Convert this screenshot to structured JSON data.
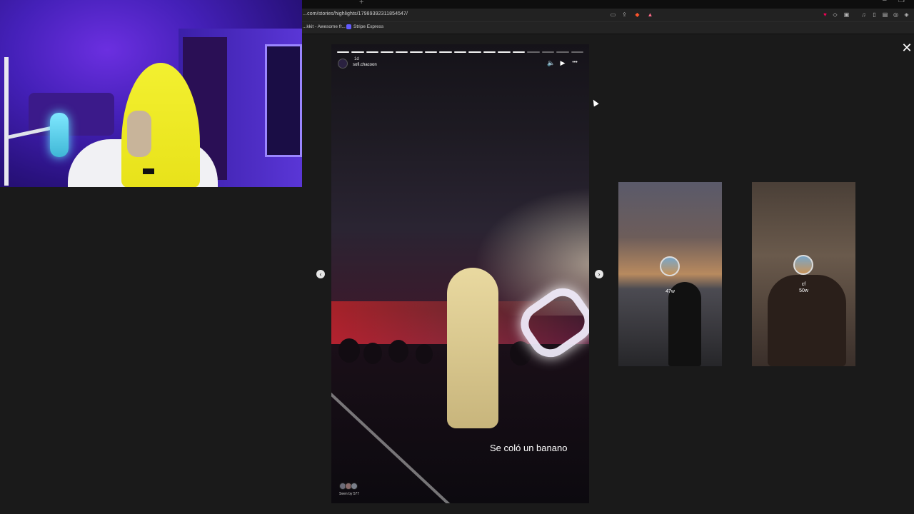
{
  "browser": {
    "url": "...com/stories/highlights/17989392311854547/",
    "bookmarks": [
      {
        "label": "...kkit - Awesome fr..."
      },
      {
        "label": "Stripe Express"
      }
    ],
    "new_tab_glyph": "+"
  },
  "story": {
    "progress_total": 17,
    "progress_done": 13,
    "time_ago": "1d",
    "username": "sofi.chacoon",
    "caption": "Se coló un banano",
    "seen_by": "Seen by 577",
    "controls": {
      "mute": "🔈",
      "play": "▶",
      "more": "•••"
    }
  },
  "viewer": {
    "close": "✕",
    "prev": "‹",
    "next": "›"
  },
  "up_next": [
    {
      "time_ago": "47w",
      "username": ""
    },
    {
      "time_ago": "50w",
      "username": "cf"
    }
  ],
  "colors": {
    "page_bg": "#1a1a1a",
    "webcam_purple": "#4420b8",
    "banana_yellow": "#f3f030"
  }
}
